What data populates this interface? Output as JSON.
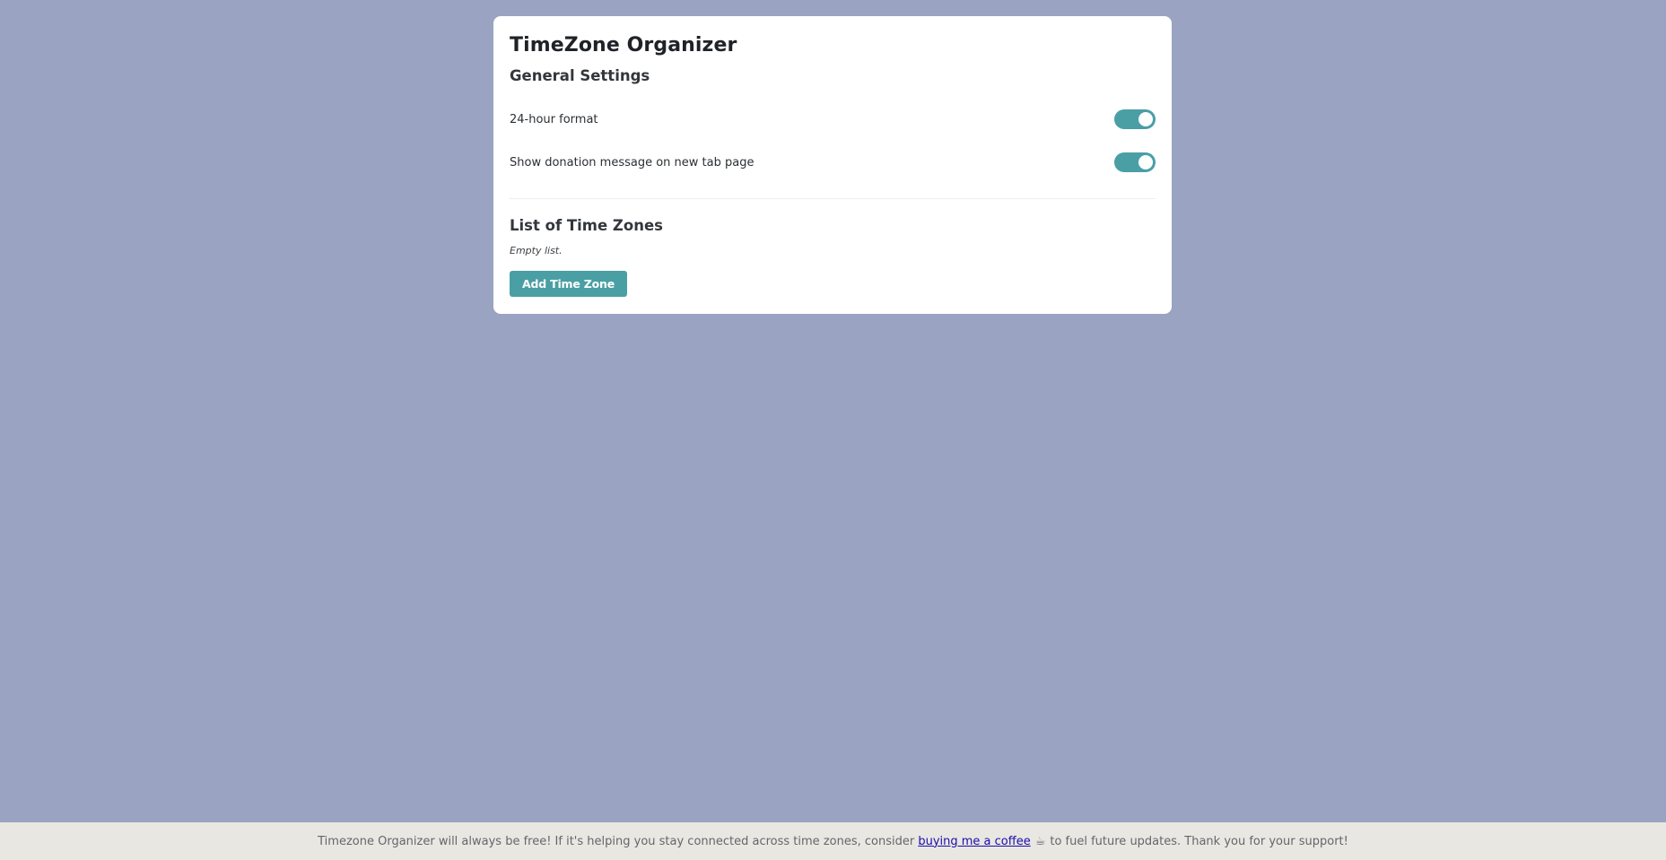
{
  "app": {
    "title": "TimeZone Organizer"
  },
  "general_settings": {
    "heading": "General Settings",
    "settings": [
      {
        "label": "24-hour format",
        "enabled": true
      },
      {
        "label": "Show donation message on new tab page",
        "enabled": true
      }
    ]
  },
  "time_zones": {
    "heading": "List of Time Zones",
    "empty_text": "Empty list.",
    "add_button_label": "Add Time Zone"
  },
  "footer": {
    "text_before": "Timezone Organizer will always be free! If it's helping you stay connected across time zones, consider",
    "link_text": "buying me a coffee",
    "coffee_icon": "☕",
    "text_after": "to fuel future updates. Thank you for your support!"
  },
  "colors": {
    "background": "#9aa3c2",
    "accent": "#4a9fa5",
    "footer_background": "#e9e7e2",
    "link": "#1a0dab"
  }
}
